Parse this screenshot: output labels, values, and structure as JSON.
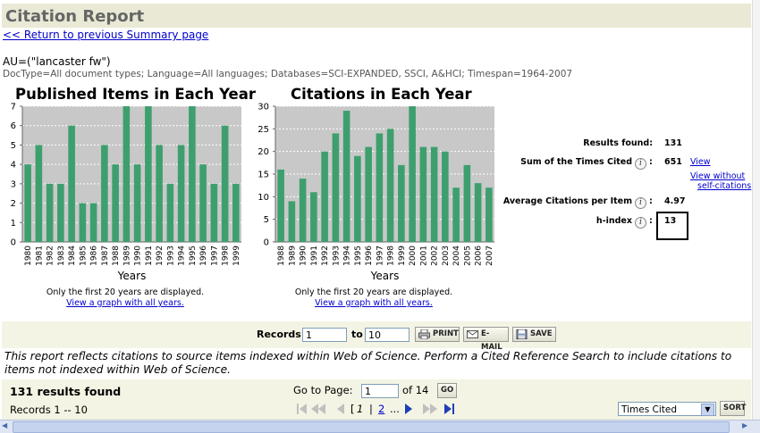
{
  "header": {
    "title": "Citation Report"
  },
  "nav": {
    "return_link": "<< Return to previous Summary page"
  },
  "query": {
    "line1": "AU=(\"lancaster fw\")",
    "line2": "DocType=All document types; Language=All languages; Databases=SCI-EXPANDED, SSCI, A&HCI; Timespan=1964-2007"
  },
  "chart_data": [
    {
      "type": "bar",
      "title": "Published Items in Each Year",
      "xlabel": "Years",
      "categories": [
        "1980",
        "1981",
        "1982",
        "1983",
        "1984",
        "1985",
        "1986",
        "1987",
        "1988",
        "1989",
        "1990",
        "1991",
        "1992",
        "1993",
        "1994",
        "1995",
        "1996",
        "1997",
        "1998",
        "1999"
      ],
      "values": [
        4,
        5,
        3,
        3,
        6,
        2,
        2,
        5,
        4,
        7,
        4,
        7,
        5,
        3,
        5,
        7,
        4,
        3,
        6,
        3
      ],
      "ylim": [
        0,
        7
      ],
      "yticks": [
        "0",
        "1",
        "2",
        "3",
        "4",
        "5",
        "6",
        "7"
      ],
      "grid": true,
      "bar_color": "#3e9f6e",
      "note": "Only the first 20 years are displayed.",
      "link": "View a graph with all years."
    },
    {
      "type": "bar",
      "title": "Citations in Each Year",
      "xlabel": "Years",
      "categories": [
        "1988",
        "1989",
        "1990",
        "1991",
        "1992",
        "1993",
        "1994",
        "1995",
        "1996",
        "1997",
        "1998",
        "1999",
        "2000",
        "2001",
        "2002",
        "2003",
        "2004",
        "2005",
        "2006",
        "2007"
      ],
      "values": [
        16,
        9,
        14,
        11,
        20,
        24,
        29,
        19,
        21,
        24,
        25,
        17,
        30,
        21,
        21,
        20,
        12,
        17,
        13,
        12
      ],
      "ylim": [
        0,
        30
      ],
      "yticks": [
        "0",
        "5",
        "10",
        "15",
        "20",
        "25",
        "30"
      ],
      "grid": true,
      "bar_color": "#3e9f6e",
      "note": "Only the first 20 years are displayed.",
      "link": "View a graph with all years."
    }
  ],
  "stats": {
    "results_found_label": "Results found:",
    "results_found": "131",
    "sum_cited_label": "Sum of the Times Cited",
    "sum_cited": "651",
    "view_link": "View",
    "view_without_1": "View without",
    "view_without_2": "self-citations",
    "avg_label": "Average Citations per Item",
    "avg_value": "4.97",
    "hindex_label": "h-index",
    "hindex_value": "13",
    "colon": ":"
  },
  "records": {
    "label": "Records",
    "from": "1",
    "to_label": "to",
    "to": "10",
    "print": "PRINT",
    "email": "E-MAIL",
    "save": "SAVE"
  },
  "disclaimer": "This report reflects citations to source items indexed within Web of Science. Perform a Cited Reference Search to include citations to items not indexed within Web of Science.",
  "results": {
    "found": "131 results found",
    "records_range": "Records 1 -- 10",
    "goto_label": "Go to Page:",
    "goto_value": "1",
    "of_pages": "of 14",
    "go": "GO",
    "page_bracket_open": "[",
    "page_current": "1",
    "page_sep": "|",
    "page_next": "2",
    "page_ellipsis": "...",
    "sort_value": "Times Cited",
    "sort_button": "SORT"
  },
  "colors": {
    "bar": "#3e9f6e",
    "plot_bg": "#c8c8c8",
    "title_bg": "#e9e9d5",
    "link": "#0000cc"
  }
}
